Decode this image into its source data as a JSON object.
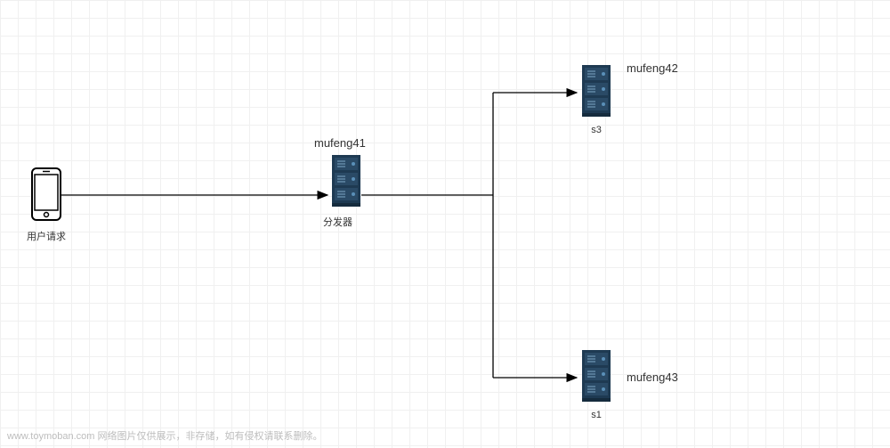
{
  "diagram": {
    "client": {
      "label": "用户请求"
    },
    "dispatcher": {
      "title": "mufeng41",
      "caption": "分发器"
    },
    "server_top": {
      "title": "mufeng42",
      "caption": "s3"
    },
    "server_bottom": {
      "title": "mufeng43",
      "caption": "s1"
    }
  },
  "watermark": "www.toymoban.com 网络图片仅供展示，非存储，如有侵权请联系删除。"
}
